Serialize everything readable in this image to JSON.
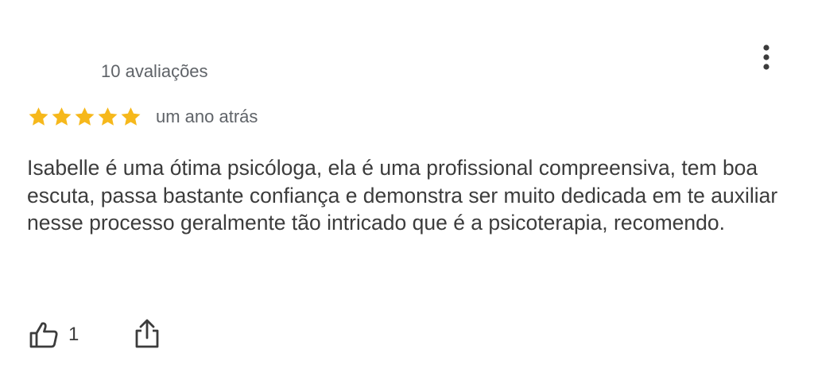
{
  "review": {
    "reviewer_count": "10 avaliações",
    "rating": 5,
    "rating_max": 5,
    "time": "um ano atrás",
    "text": "Isabelle é uma ótima psicóloga, ela é uma profissional compreensiva, tem boa escuta, passa bastante confiança e demonstra ser muito dedicada em te auxiliar nesse processo geralmente tão intricado que é a psicoterapia, recomendo.",
    "likes": "1"
  },
  "icons": {
    "star": "star-icon",
    "more": "more-vert-icon",
    "like": "thumb-up-icon",
    "share": "share-icon"
  },
  "colors": {
    "star": "#F6B81B",
    "text": "#3C3C3C",
    "meta": "#5F6368",
    "icon": "#3C3C3C"
  }
}
